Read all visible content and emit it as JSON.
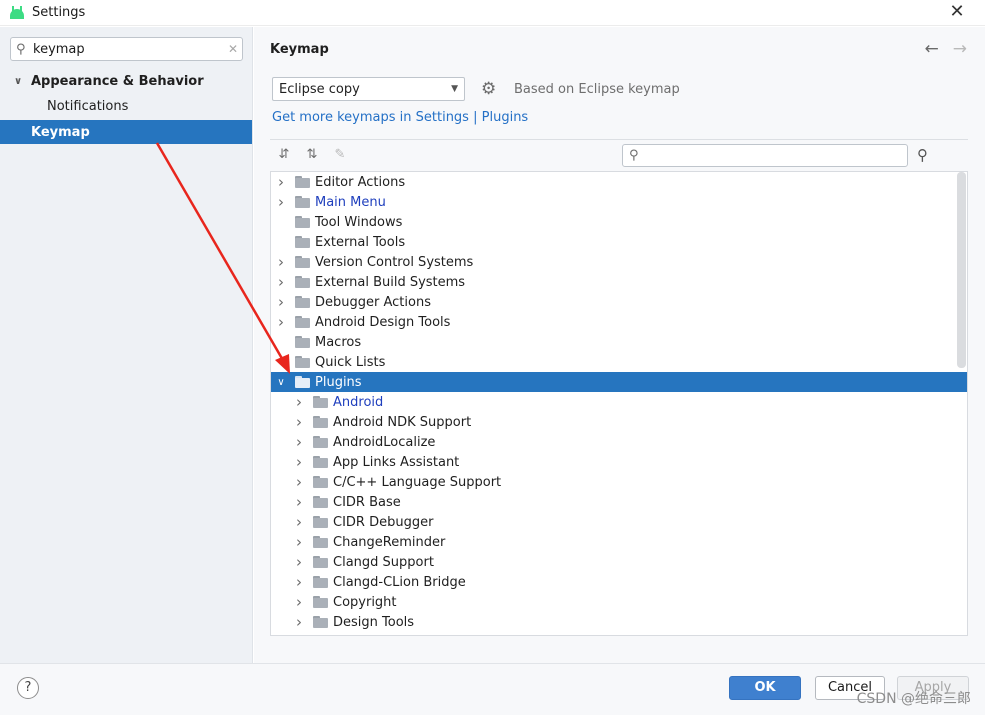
{
  "window": {
    "title": "Settings"
  },
  "sidebar": {
    "search_value": "keymap",
    "items": [
      {
        "label": "Appearance & Behavior",
        "expanded": true
      },
      {
        "label": "Notifications"
      },
      {
        "label": "Keymap",
        "selected": true
      }
    ]
  },
  "content": {
    "title": "Keymap",
    "selected_keymap": "Eclipse copy",
    "based_on": "Based on Eclipse keymap",
    "get_more_link": "Get more keymaps in Settings",
    "separator": "|",
    "plugins_link": "Plugins"
  },
  "tree": {
    "top": [
      {
        "label": "Editor Actions",
        "has_arrow": true
      },
      {
        "label": "Main Menu",
        "has_arrow": true,
        "link": true
      },
      {
        "label": "Tool Windows",
        "has_arrow": false
      },
      {
        "label": "External Tools",
        "has_arrow": false
      },
      {
        "label": "Version Control Systems",
        "has_arrow": true
      },
      {
        "label": "External Build Systems",
        "has_arrow": true
      },
      {
        "label": "Debugger Actions",
        "has_arrow": true
      },
      {
        "label": "Android Design Tools",
        "has_arrow": true
      },
      {
        "label": "Macros",
        "has_arrow": false
      },
      {
        "label": "Quick Lists",
        "has_arrow": false
      },
      {
        "label": "Plugins",
        "has_arrow": true,
        "expanded": true,
        "selected": true
      }
    ],
    "plugins": [
      {
        "label": "Android",
        "link": true
      },
      {
        "label": "Android NDK Support"
      },
      {
        "label": "AndroidLocalize"
      },
      {
        "label": "App Links Assistant"
      },
      {
        "label": "C/C++ Language Support"
      },
      {
        "label": "CIDR Base"
      },
      {
        "label": "CIDR Debugger"
      },
      {
        "label": "ChangeReminder"
      },
      {
        "label": "Clangd Support"
      },
      {
        "label": "Clangd-CLion Bridge"
      },
      {
        "label": "Copyright"
      },
      {
        "label": "Design Tools"
      }
    ]
  },
  "footer": {
    "help": "?",
    "ok": "OK",
    "cancel": "Cancel",
    "apply": "Apply",
    "watermark": "CSDN @绝命三郎"
  },
  "colors": {
    "accent": "#2675bf",
    "link": "#2470c6",
    "annotation": "#e8261d"
  }
}
